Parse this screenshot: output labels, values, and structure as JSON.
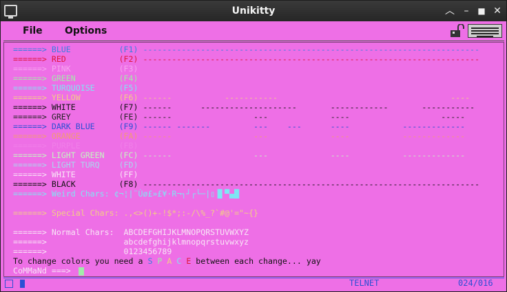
{
  "window": {
    "title": "Unikitty"
  },
  "menu": {
    "file": "File",
    "options": "Options"
  },
  "colors": {
    "background": "#ee6fe6",
    "black": "#111111",
    "blue": "#3a7fe0",
    "red": "#e0153c",
    "pink": "#f6a6f0",
    "green": "#a2ecaa",
    "turquoise": "#7fe6f4",
    "yellow": "#f2ce84",
    "white": "#111111",
    "grey": "#222222",
    "dark_blue": "#2b4fd4",
    "orange": "#f29a74",
    "purple": "#f07fe8",
    "light_green": "#c4f7c0",
    "light_turq": "#a8d8ee",
    "white2": "#f8e6f6",
    "black2": "#111111"
  },
  "terminal": {
    "lines": [
      {
        "arrow": "======> ",
        "name": "BLUE          ",
        "key": "(F1) ",
        "bar": "----------------------------------------------------------------------",
        "color": "#3a7fe0",
        "arrow_color": "#3a7fe0"
      },
      {
        "arrow": "======> ",
        "name": "RED           ",
        "key": "(F2) ",
        "bar": "----------------------------------------------------------------------",
        "color": "#e0153c",
        "arrow_color": "#e0153c"
      },
      {
        "arrow": "======> ",
        "name": "PINK          ",
        "key": "(F3) ",
        "bar": "",
        "color": "#f6a6f0",
        "arrow_color": "#f6a6f0"
      },
      {
        "arrow": "======> ",
        "name": "GREEN         ",
        "key": "(F4) ",
        "bar": "",
        "color": "#a2ecaa",
        "arrow_color": "#a2ecaa"
      },
      {
        "arrow": "======> ",
        "name": "TURQUOISE     ",
        "key": "(F5) ",
        "bar": "",
        "color": "#7fe6f4",
        "arrow_color": "#7fe6f4"
      },
      {
        "arrow": "======> ",
        "name": "YELLOW        ",
        "key": "(F6) ",
        "bar": "------           -----------                                    ----",
        "color": "#f2ce84",
        "arrow_color": "#f2ce84"
      },
      {
        "arrow": "======> ",
        "name": "WHITE         ",
        "key": "(F7) ",
        "bar": "------      --------------------       ------------       -----------",
        "color": "#111111",
        "arrow_color": "#111111"
      },
      {
        "arrow": "======> ",
        "name": "GREY          ",
        "key": "(FE) ",
        "bar": "------                 ---             ----                   -----",
        "color": "#222222",
        "arrow_color": "#222222"
      },
      {
        "arrow": "======> ",
        "name": "DARK BLUE     ",
        "key": "(F9) ",
        "bar": "------ -------         ---    ---      ----           -------------",
        "color": "#2b4fd4",
        "arrow_color": "#2b4fd4"
      },
      {
        "arrow": "======> ",
        "name": "ORANGE        ",
        "key": "(FA) ",
        "bar": "------                 ---             ----           -------------",
        "color": "#f29a74",
        "arrow_color": "#f29a74"
      },
      {
        "arrow": "======> ",
        "name": "PURPLE        ",
        "key": "(FB) ",
        "bar": "",
        "color": "#f07fe8",
        "arrow_color": "#f07fe8"
      },
      {
        "arrow": "======> ",
        "name": "LIGHT GREEN   ",
        "key": "(FC) ",
        "bar": "------                 ---             ----           -------------",
        "color": "#c4f7c0",
        "arrow_color": "#c4f7c0"
      },
      {
        "arrow": "======> ",
        "name": "LIGHT TURQ    ",
        "key": "(FD) ",
        "bar": "",
        "color": "#a8d8ee",
        "arrow_color": "#a8d8ee"
      },
      {
        "arrow": "======> ",
        "name": "WHITE         ",
        "key": "(FF) ",
        "bar": "",
        "color": "#f8e6f6",
        "arrow_color": "#f8e6f6"
      },
      {
        "arrow": "======> ",
        "name": "BLACK         ",
        "key": "(F8) ",
        "bar": "----------------------------------------------------------------------",
        "color": "#111111",
        "arrow_color": "#111111"
      }
    ],
    "weird_chars": "======> Weird Chars: ¢¬¦|¨Ùø£»£¥·R¬┐┘┌└─|▯▐▌▀▄█",
    "special_chars": "======> Special Chars: .,<>()+-!$*;:-/\\%_?`#@'=\"~{}",
    "normal_label": "======> Normal Chars:",
    "normal_upper": "ABCDEFGHIJKLMNOPQRSTUVWXYZ",
    "normal_lower": "abcdefghijklmnopqrstuvwxyz",
    "normal_digits": "0123456789",
    "arrow_only": "======>",
    "change_text_1": "To change colors you need a ",
    "space_letters": [
      "S",
      "P",
      "A",
      "C",
      "E"
    ],
    "space_colors": [
      "#3a7fe0",
      "#a2ecaa",
      "#f2ce84",
      "#7fe6f4",
      "#e0153c"
    ],
    "change_text_2": " between each change... yay",
    "command_prompt": "CoMMaNd ===> "
  },
  "status": {
    "mode": "TELNET",
    "counter": "024/016"
  }
}
